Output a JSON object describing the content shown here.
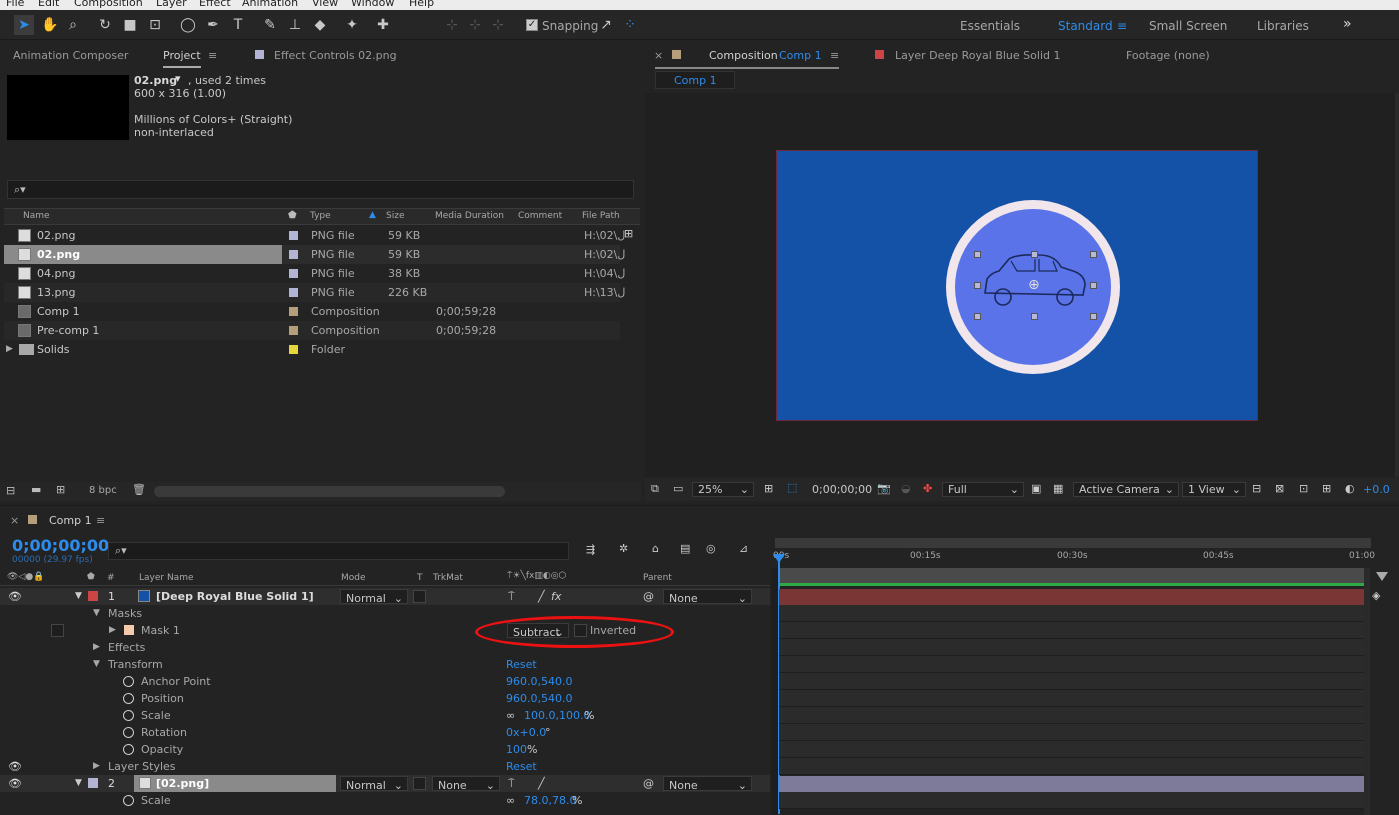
{
  "menu": [
    "File",
    "Edit",
    "Composition",
    "Layer",
    "Effect",
    "Animation",
    "View",
    "Window",
    "Help"
  ],
  "toolbar": {
    "snapping": "Snapping"
  },
  "workspaces": [
    "Essentials",
    "Standard",
    "Small Screen",
    "Libraries"
  ],
  "workspace_more": "»",
  "project": {
    "tabs": [
      "Animation Composer",
      "Project",
      "Effect Controls 02.png"
    ],
    "tab_menu": "≡",
    "preview_name": "02.png",
    "preview_used": ", used 2 times",
    "preview_dims": "600 x 316 (1.00)",
    "preview_colors": "Millions of Colors+ (Straight)",
    "preview_interlace": "non-interlaced",
    "search_icon": "⌕▾",
    "columns": [
      "Name",
      "Type",
      "Size",
      "Media Duration",
      "Comment",
      "File Path"
    ],
    "items": [
      {
        "name": "02.png",
        "type": "PNG file",
        "size": "59 KB",
        "duration": "",
        "path": "H:\\02\\ل",
        "color": "#b3b3d6",
        "kind": "png"
      },
      {
        "name": "02.png",
        "type": "PNG file",
        "size": "59 KB",
        "duration": "",
        "path": "H:\\02\\ل",
        "color": "#b3b3d6",
        "kind": "png"
      },
      {
        "name": "04.png",
        "type": "PNG file",
        "size": "38 KB",
        "duration": "",
        "path": "H:\\04\\ل",
        "color": "#b3b3d6",
        "kind": "png"
      },
      {
        "name": "13.png",
        "type": "PNG file",
        "size": "226 KB",
        "duration": "",
        "path": "H:\\13\\ل",
        "color": "#b3b3d6",
        "kind": "png"
      },
      {
        "name": "Comp 1",
        "type": "Composition",
        "size": "",
        "duration": "0;00;59;28",
        "path": "",
        "color": "#b59f7a",
        "kind": "comp"
      },
      {
        "name": "Pre-comp 1",
        "type": "Composition",
        "size": "",
        "duration": "0;00;59;28",
        "path": "",
        "color": "#b59f7a",
        "kind": "comp"
      },
      {
        "name": "Solids",
        "type": "Folder",
        "size": "",
        "duration": "",
        "path": "",
        "color": "#e6d63a",
        "kind": "folder"
      }
    ],
    "bpc": "8 bpc"
  },
  "composition": {
    "tab_prefix": "Composition",
    "tab_name": "Comp 1",
    "layer_tab": "Layer Deep Royal Blue Solid 1",
    "footage_tab": "Footage (none)",
    "breadcrumb": "Comp 1",
    "bg_color": "#1352a6",
    "circle_color": "#5a73e8",
    "ring_color": "#f0e6ec",
    "zoom": "25%",
    "timecode": "0;00;00;00",
    "resolution": "Full",
    "camera": "Active Camera",
    "views": "1 View",
    "offset": "+0.0"
  },
  "timeline": {
    "tab": "Comp 1",
    "timecode": "0;00;00;00",
    "fps": "00000 (29.97 fps)",
    "headers": {
      "num": "#",
      "name": "Layer Name",
      "mode": "Mode",
      "t": "T",
      "trkmat": "TrkMat",
      "parent": "Parent"
    },
    "ruler": [
      "00s",
      "00:15s",
      "00:30s",
      "00:45s",
      "01:00"
    ],
    "layer1": {
      "num": "1",
      "name": "[Deep Royal Blue Solid 1]",
      "mode": "Normal",
      "parent": "None",
      "color": "#c44"
    },
    "masks_label": "Masks",
    "mask1": "Mask 1",
    "mask_mode": "Subtract",
    "mask_inverted": "Inverted",
    "effects": "Effects",
    "transform": "Transform",
    "reset": "Reset",
    "props": [
      {
        "name": "Anchor Point",
        "value": "960.0,540.0"
      },
      {
        "name": "Position",
        "value": "960.0,540.0"
      },
      {
        "name": "Scale",
        "value": "100.0,100.0",
        "suffix": "%"
      },
      {
        "name": "Rotation",
        "value": "0x+0.0",
        "suffix": "°"
      },
      {
        "name": "Opacity",
        "value": "100",
        "suffix": "%"
      }
    ],
    "layer_styles": "Layer Styles",
    "layer2": {
      "num": "2",
      "name": "[02.png]",
      "mode": "Normal",
      "trkmat": "None",
      "parent": "None"
    },
    "scale2": {
      "name": "Scale",
      "value": "78.0,78.0",
      "suffix": "%"
    }
  }
}
